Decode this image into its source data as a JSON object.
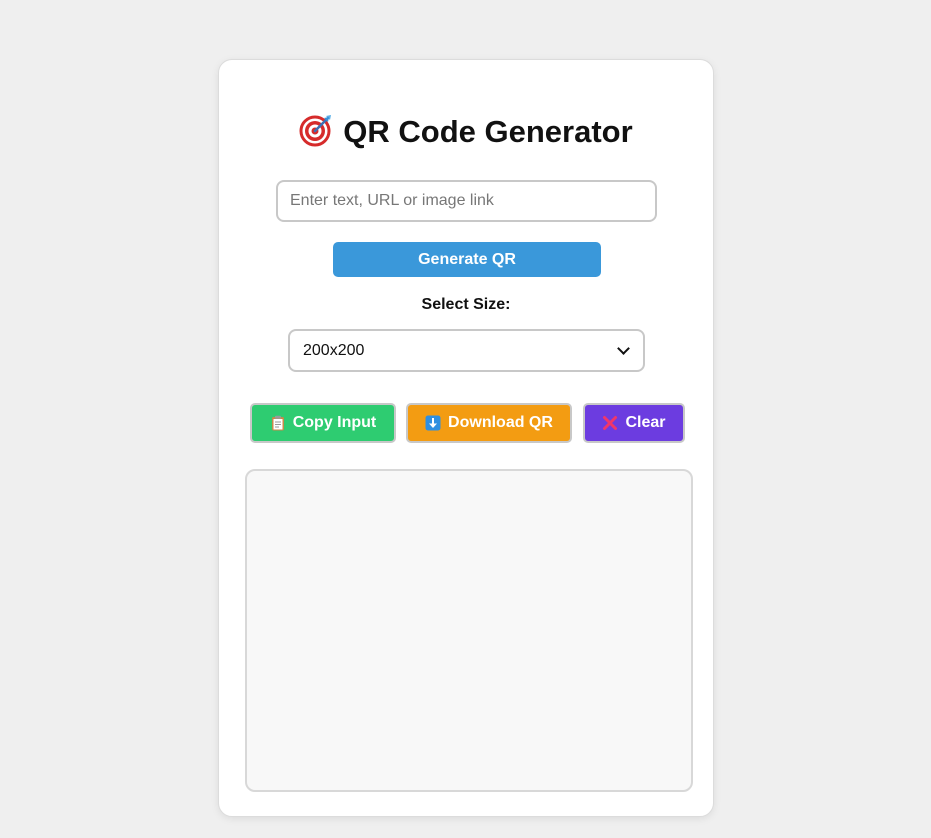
{
  "header": {
    "title": "QR Code Generator",
    "title_icon": "dart-target-icon"
  },
  "input": {
    "placeholder": "Enter text, URL or image link",
    "value": ""
  },
  "generate_button": {
    "label": "Generate QR",
    "color": "#3a98da"
  },
  "size": {
    "label": "Select Size:",
    "selected": "200x200"
  },
  "actions": {
    "copy": {
      "label": "Copy Input",
      "icon": "clipboard-icon",
      "color": "#2ecc71"
    },
    "download": {
      "label": "Download QR",
      "icon": "down-arrow-icon",
      "color": "#f39c12"
    },
    "clear": {
      "label": "Clear",
      "icon": "cross-mark-icon",
      "color": "#6c3ce0"
    }
  },
  "colors": {
    "page_background": "#efefef",
    "card_background": "#ffffff",
    "output_background": "#f8f8f8"
  }
}
